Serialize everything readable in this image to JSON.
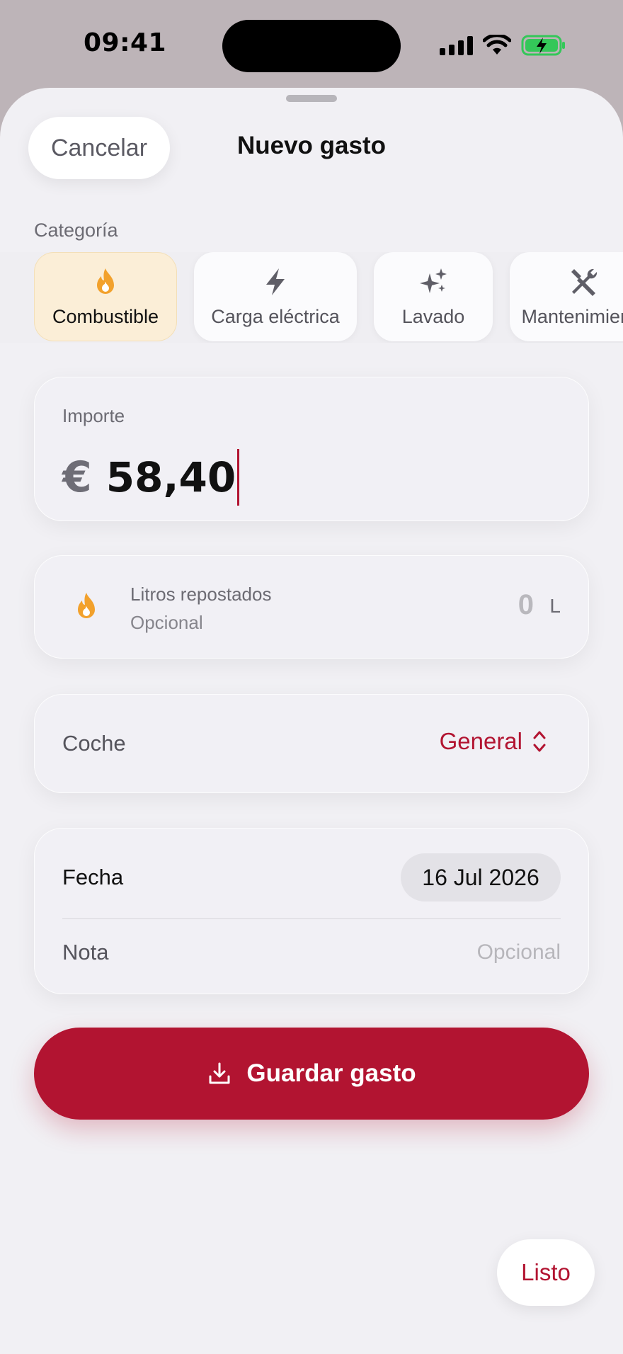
{
  "status_bar": {
    "time": "09:41"
  },
  "header": {
    "cancel_label": "Cancelar",
    "title": "Nuevo gasto"
  },
  "category": {
    "label": "Categoría",
    "items": [
      {
        "label": "Combustible",
        "icon": "flame-icon",
        "selected": true
      },
      {
        "label": "Carga eléctrica",
        "icon": "bolt-icon",
        "selected": false
      },
      {
        "label": "Lavado",
        "icon": "sparkles-icon",
        "selected": false
      },
      {
        "label": "Mantenimiento",
        "icon": "wrench-screwdriver-icon",
        "selected": false
      }
    ]
  },
  "amount": {
    "label": "Importe",
    "currency": "€",
    "value": "58,40"
  },
  "litros": {
    "title": "Litros repostados",
    "subtitle": "Opcional",
    "value": "0",
    "unit": "L"
  },
  "coche": {
    "label": "Coche",
    "value": "General"
  },
  "details": {
    "fecha_label": "Fecha",
    "fecha_value": "16 Jul 2026",
    "nota_label": "Nota",
    "nota_placeholder": "Opcional"
  },
  "save_label": "Guardar gasto",
  "keyboard_done_label": "Listo",
  "colors": {
    "accent": "#b21431",
    "flame": "#f2a12c",
    "selected_chip": "#fbeed7",
    "background": "#f1f0f4"
  }
}
